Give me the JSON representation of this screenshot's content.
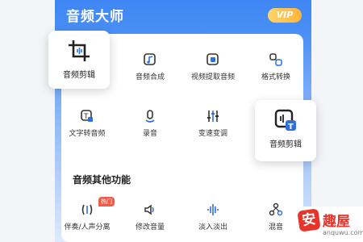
{
  "app": {
    "title": "音频大师",
    "vip_label": "VIP"
  },
  "grid": [
    {
      "label": "音频合成",
      "icon": "music-note-icon"
    },
    {
      "label": "视频提取音频",
      "icon": "video-extract-icon"
    },
    {
      "label": "格式转换",
      "icon": "format-convert-icon"
    },
    {
      "label": "文字转音频",
      "icon": "text-to-audio-icon"
    },
    {
      "label": "录音",
      "icon": "microphone-icon"
    },
    {
      "label": "变速变调",
      "icon": "equalizer-icon"
    }
  ],
  "floating": {
    "left": {
      "label": "音频剪辑",
      "icon": "crop-icon"
    },
    "right": {
      "label": "音频剪辑",
      "icon": "audio-edit-icon"
    }
  },
  "section": {
    "title": "音频其他功能"
  },
  "other": [
    {
      "label": "伴奏/人声分离",
      "icon": "split-voice-icon",
      "badge": "热门"
    },
    {
      "label": "修改音量",
      "icon": "volume-icon"
    },
    {
      "label": "淡入淡出",
      "icon": "waveform-icon"
    },
    {
      "label": "混音",
      "icon": "mix-icon"
    }
  ],
  "watermark": {
    "logo_char": "安",
    "name": "趣屋",
    "url": "anquwu.com"
  },
  "colors": {
    "primary": "#3e86f4",
    "vip": "#ffb33a",
    "badge": "#f25a4a",
    "icon": "#2f6fe0"
  }
}
